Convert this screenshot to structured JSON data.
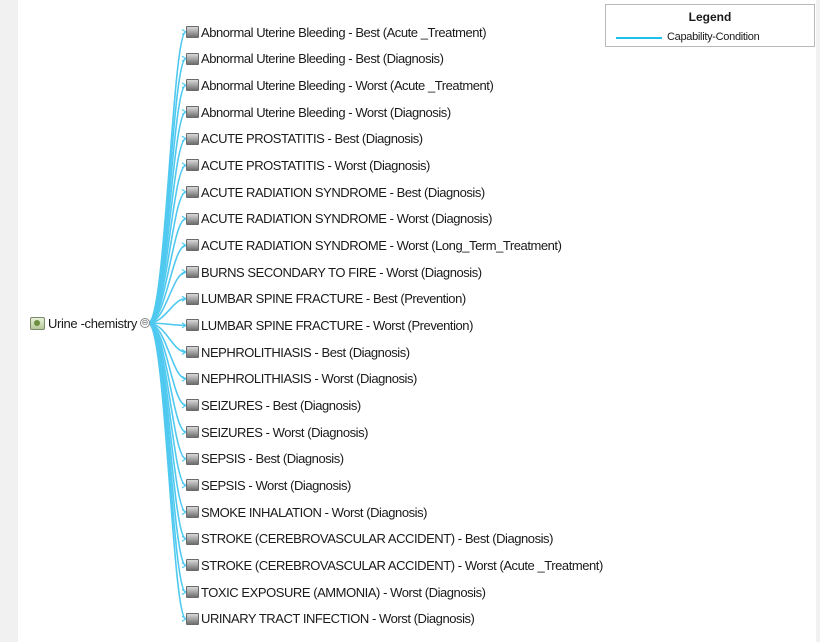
{
  "colors": {
    "edge": "#4fc9f0",
    "legend_line": "#1cc0ee"
  },
  "root": {
    "label": "Urine -chemistry",
    "toggle": "⊖",
    "icon": "concept-node-icon"
  },
  "children": [
    {
      "label": "Abnormal Uterine Bleeding - Best (Acute _Treatment)"
    },
    {
      "label": "Abnormal Uterine Bleeding - Best (Diagnosis)"
    },
    {
      "label": "Abnormal Uterine Bleeding - Worst (Acute _Treatment)"
    },
    {
      "label": "Abnormal Uterine Bleeding - Worst (Diagnosis)"
    },
    {
      "label": "ACUTE PROSTATITIS - Best (Diagnosis)"
    },
    {
      "label": "ACUTE PROSTATITIS - Worst (Diagnosis)"
    },
    {
      "label": "ACUTE RADIATION SYNDROME - Best (Diagnosis)"
    },
    {
      "label": "ACUTE RADIATION SYNDROME - Worst (Diagnosis)"
    },
    {
      "label": "ACUTE RADIATION SYNDROME - Worst (Long_Term_Treatment)"
    },
    {
      "label": "BURNS SECONDARY TO FIRE - Worst (Diagnosis)"
    },
    {
      "label": "LUMBAR SPINE FRACTURE - Best (Prevention)"
    },
    {
      "label": "LUMBAR SPINE FRACTURE - Worst (Prevention)"
    },
    {
      "label": "NEPHROLITHIASIS - Best (Diagnosis)"
    },
    {
      "label": "NEPHROLITHIASIS - Worst (Diagnosis)"
    },
    {
      "label": "SEIZURES - Best (Diagnosis)"
    },
    {
      "label": "SEIZURES - Worst (Diagnosis)"
    },
    {
      "label": "SEPSIS - Best (Diagnosis)"
    },
    {
      "label": "SEPSIS - Worst (Diagnosis)"
    },
    {
      "label": "SMOKE INHALATION - Worst (Diagnosis)"
    },
    {
      "label": "STROKE (CEREBROVASCULAR ACCIDENT) - Best (Diagnosis)"
    },
    {
      "label": "STROKE (CEREBROVASCULAR ACCIDENT) - Worst (Acute _Treatment)"
    },
    {
      "label": "TOXIC EXPOSURE (AMMONIA) - Worst (Diagnosis)"
    },
    {
      "label": "URINARY TRACT INFECTION - Worst (Diagnosis)"
    }
  ],
  "legend": {
    "title": "Legend",
    "entry": "Capability-Condition"
  }
}
